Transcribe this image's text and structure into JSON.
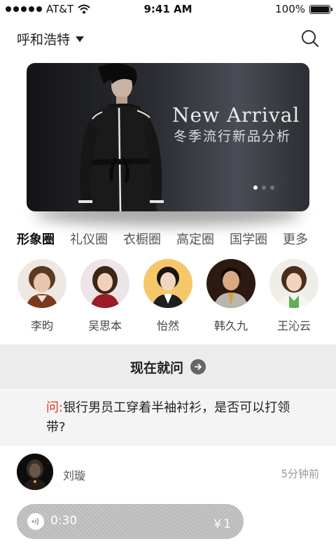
{
  "status": {
    "carrier": "AT&T",
    "time": "9:41 AM",
    "battery": "100%"
  },
  "header": {
    "city": "呼和浩特"
  },
  "banner": {
    "title": "New Arrival",
    "subtitle": "冬季流行新品分析",
    "slides": 3,
    "active_slide": 1
  },
  "tabs": [
    {
      "label": "形象圈",
      "active": true
    },
    {
      "label": "礼仪圈",
      "active": false
    },
    {
      "label": "衣橱圈",
      "active": false
    },
    {
      "label": "高定圈",
      "active": false
    },
    {
      "label": "国学圈",
      "active": false
    },
    {
      "label": "更多",
      "active": false
    }
  ],
  "experts": [
    {
      "name": "李昀"
    },
    {
      "name": "吴思本"
    },
    {
      "name": "怡然"
    },
    {
      "name": "韩久九"
    },
    {
      "name": "王沁云"
    }
  ],
  "ask": {
    "label": "现在就问"
  },
  "question": {
    "prefix": "问:",
    "text": "银行男员工穿着半袖衬衫，是否可以打领带?"
  },
  "answer": {
    "name": "刘璇",
    "time": "5分钟前",
    "audio": {
      "duration": "0:30",
      "price": "￥1"
    }
  }
}
